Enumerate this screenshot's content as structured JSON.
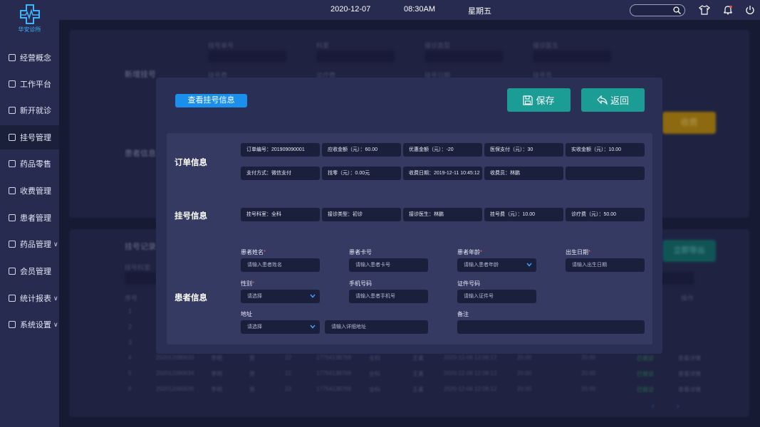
{
  "app": {
    "logo_text": "华安诊所"
  },
  "topbar": {
    "date": "2020-12-07",
    "time": "08:30AM",
    "weekday": "星期五",
    "icons": [
      "shirt-icon",
      "bell-icon",
      "power-icon"
    ]
  },
  "sidebar": {
    "items": [
      {
        "label": "经营概念",
        "icon": "overview-icon",
        "chevron": false
      },
      {
        "label": "工作平台",
        "icon": "monitor-icon",
        "chevron": false
      },
      {
        "label": "新开就诊",
        "icon": "window-icon",
        "chevron": false
      },
      {
        "label": "挂号管理",
        "icon": "register-icon",
        "chevron": false,
        "active": true
      },
      {
        "label": "药品零售",
        "icon": "retail-icon",
        "chevron": false
      },
      {
        "label": "收费管理",
        "icon": "fee-icon",
        "chevron": false
      },
      {
        "label": "患者管理",
        "icon": "patient-icon",
        "chevron": false
      },
      {
        "label": "药品管理",
        "icon": "drug-icon",
        "chevron": true
      },
      {
        "label": "会员管理",
        "icon": "member-icon",
        "chevron": false
      },
      {
        "label": "统计报表",
        "icon": "chart-icon",
        "chevron": true
      },
      {
        "label": "系统设置",
        "icon": "gear-icon",
        "chevron": true
      }
    ]
  },
  "modal": {
    "title": "查看挂号信息",
    "save_label": "保存",
    "back_label": "返回",
    "sections": {
      "order": "订单信息",
      "register": "挂号信息",
      "patient": "患者信息"
    },
    "order_fields": [
      "订单编号：201909090001",
      "应收金额（元）：60.00",
      "优惠金额（元）：-20",
      "医保支付（元）：30",
      "实收金额（元）：10.00",
      "支付方式：微信支付",
      "找零（元）：0.00元",
      "收费日期：2019-12-11 10:45:12",
      "收费员：林鹏",
      ""
    ],
    "register_fields": [
      "挂号科室：全科",
      "接诊类型：初诊",
      "接诊医生：林鹏",
      "挂号费（元）：10.00",
      "诊疗费（元）：50.00"
    ],
    "patient": {
      "name": {
        "label": "患者姓名",
        "placeholder": "请输入患者姓名"
      },
      "card": {
        "label": "患者卡号",
        "placeholder": "请输入患者卡号"
      },
      "age": {
        "label": "患者年龄",
        "placeholder": "请输入患者年龄"
      },
      "birth": {
        "label": "出生日期",
        "placeholder": "请输入出生日期"
      },
      "gender": {
        "label": "性别",
        "placeholder": "请选择"
      },
      "phone": {
        "label": "手机号码",
        "placeholder": "请输入患者手机号"
      },
      "idcard": {
        "label": "证件号码",
        "placeholder": "请输入证件号"
      },
      "address": {
        "label": "地址",
        "placeholder": "请选择",
        "detail_placeholder": "请输入详细地址"
      },
      "note": {
        "label": "备注",
        "placeholder": ""
      }
    }
  },
  "background": {
    "new_register": "新增挂号",
    "patient_info": "患者信息",
    "register_record": "挂号记录",
    "charge_btn": "收费",
    "export_btn": "立即导出",
    "labels": [
      "挂号单号",
      "科室",
      "接诊类型",
      "接诊医生",
      "挂号费",
      "诊疗费",
      "挂号日期",
      "挂号员",
      "挂号科室",
      "序号",
      "操作"
    ],
    "rows": [
      {
        "no": "4",
        "id": "202012090033",
        "name": "李明",
        "gender": "男",
        "age": "22",
        "phone": "17754138769",
        "dept": "全科",
        "doctor": "王素",
        "time": "2020-12-06 12:08:12",
        "fee": "20.00",
        "total": "20.00",
        "status": "已就诊",
        "op": "查看详情"
      },
      {
        "no": "5",
        "id": "202012090034",
        "name": "李明",
        "gender": "男",
        "age": "22",
        "phone": "17754138769",
        "dept": "全科",
        "doctor": "王素",
        "time": "2020-12-06 12:08:12",
        "fee": "20.00",
        "total": "20.00",
        "status": "已就诊",
        "op": "查看详情"
      },
      {
        "no": "6",
        "id": "202012090035",
        "name": "李明",
        "gender": "男",
        "age": "22",
        "phone": "17754138769",
        "dept": "全科",
        "doctor": "王素",
        "time": "2020-12-06 12:08:12",
        "fee": "20.00",
        "total": "20.00",
        "status": "已就诊",
        "op": "查看详情"
      }
    ],
    "early_rows": [
      "1",
      "2",
      "3"
    ]
  },
  "colors": {
    "accent": "#1b8fec",
    "teal": "#1b9c94",
    "bg": "#1a1f3a",
    "panel": "#343a62",
    "required": "#ff4d4f"
  }
}
